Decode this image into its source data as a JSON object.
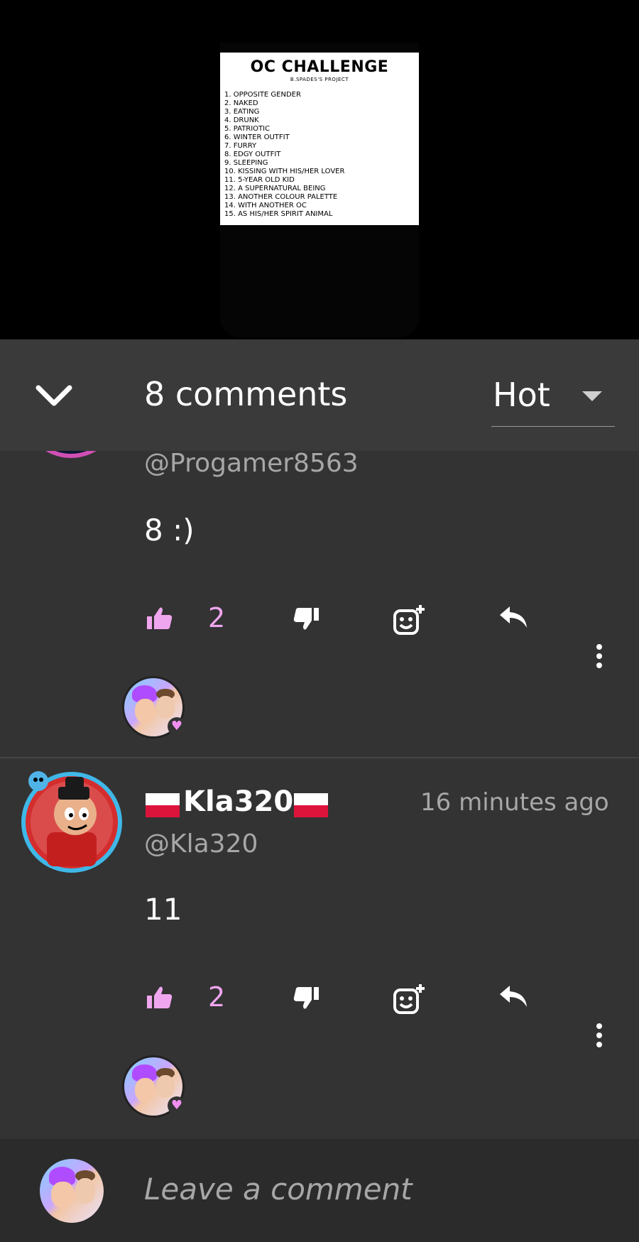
{
  "poster": {
    "title": "OC CHALLENGE",
    "subtitle": "B.SPADES'S PROJECT",
    "items": [
      "1. OPPOSITE GENDER",
      "2. NAKED",
      "3. EATING",
      "4. DRUNK",
      "5. PATRIOTIC",
      "6. WINTER OUTFIT",
      "7. FURRY",
      "8. EDGY OUTFIT",
      "9. SLEEPING",
      "10. KISSING WITH HIS/HER LOVER",
      "11. 5-YEAR OLD KID",
      "12. A SUPERNATURAL BEING",
      "13. ANOTHER COLOUR PALETTE",
      "14. WITH ANOTHER OC",
      "15. AS HIS/HER SPIRIT ANIMAL"
    ]
  },
  "header": {
    "comment_count": "8 comments",
    "sort_value": "Hot",
    "collapse_icon": "chevron-down-icon",
    "sort_icon": "caret-down-icon"
  },
  "comments": [
    {
      "handle": "@Progamer8563",
      "body": "8 :)",
      "likes": "2",
      "heart_icon": "heart-icon"
    },
    {
      "name": "Kla320",
      "handle": "@Kla320",
      "time": "16 minutes ago",
      "body": "11",
      "likes": "2",
      "heart_icon": "heart-icon"
    }
  ],
  "composer": {
    "placeholder": "Leave a comment"
  },
  "colors": {
    "background": "#333333",
    "accent_pink": "#f0a6ef",
    "muted_text": "#a7a7a7"
  }
}
